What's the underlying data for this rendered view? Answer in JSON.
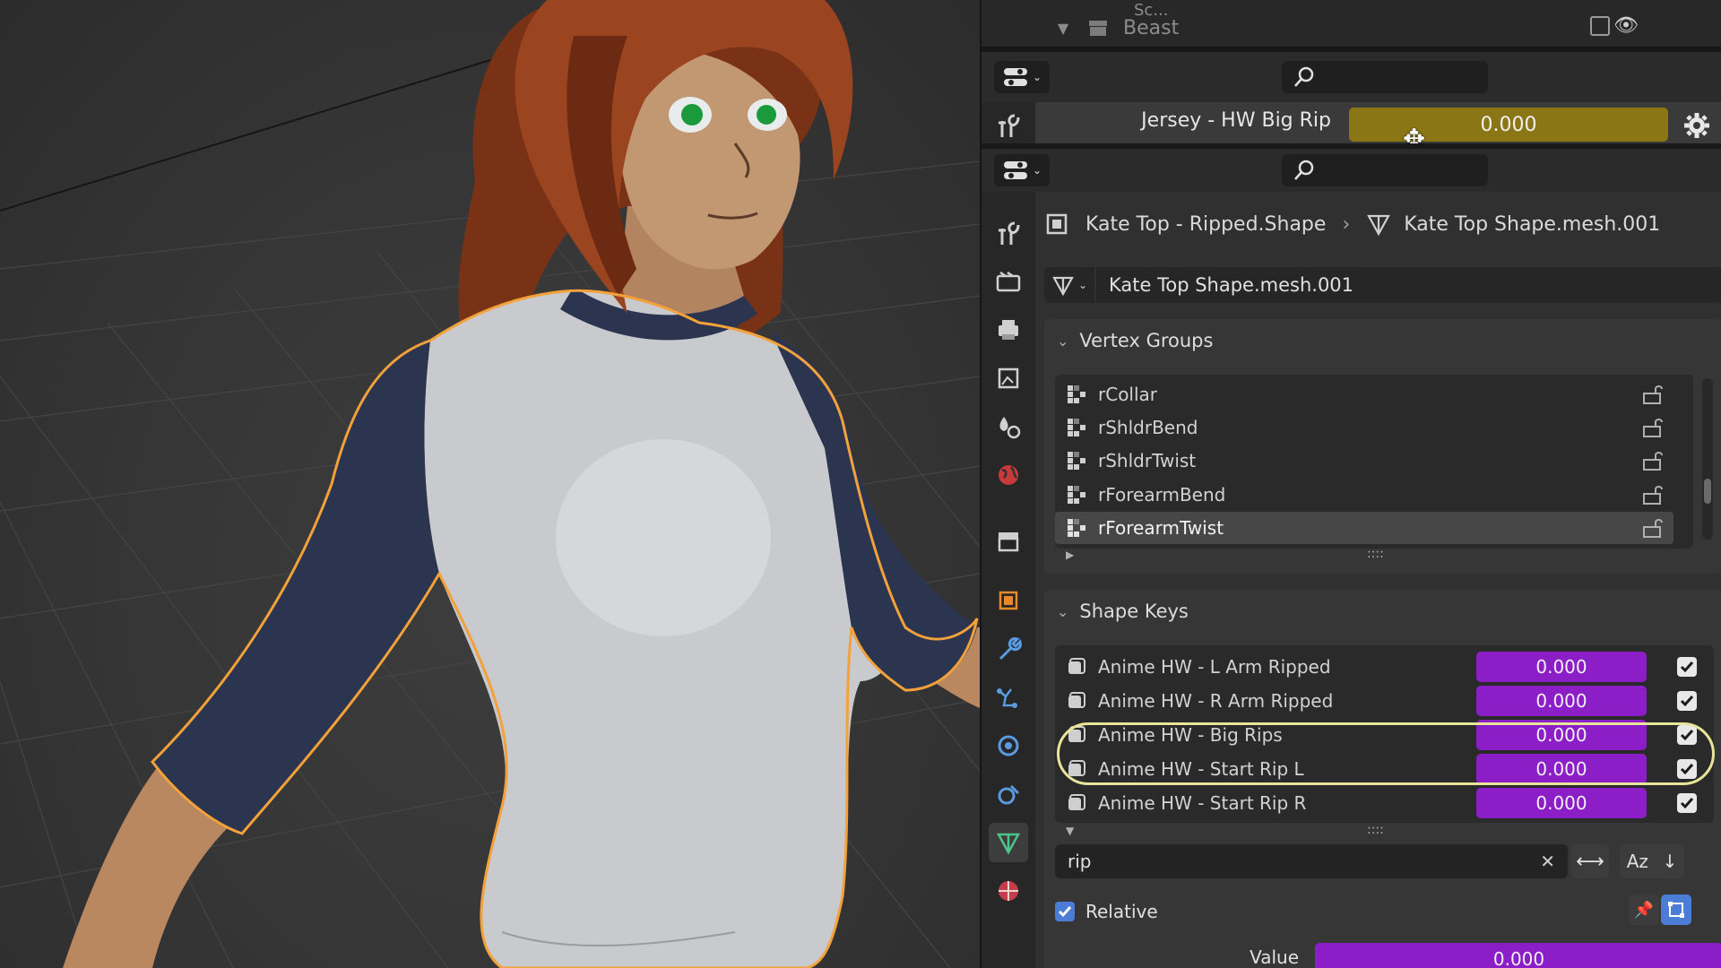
{
  "colors": {
    "selection_outline": "#f3a13a",
    "key_value_field": "#8c1ec8",
    "driver_field": "#8b7615",
    "highlight_circle": "#e8e49a",
    "shirt_sleeve": "#2c3550",
    "shirt_body": "#c8c9cc",
    "hair": "#8a3a1a",
    "eyes": "#1a9a3a"
  },
  "outliner": {
    "item_above_label": "Sc...",
    "collection_label": "Beast"
  },
  "driver_row": {
    "label": "Jersey - HW Big Rip",
    "value": "0.000"
  },
  "breadcrumb": {
    "object": "Kate Top - Ripped.Shape",
    "mesh": "Kate Top Shape.mesh.001"
  },
  "mesh_selector": {
    "name": "Kate Top Shape.mesh.001"
  },
  "vertex_groups": {
    "title": "Vertex Groups",
    "items": [
      "rCollar",
      "rShldrBend",
      "rShldrTwist",
      "rForearmBend",
      "rForearmTwist"
    ],
    "grip": "::::"
  },
  "shape_keys": {
    "title": "Shape Keys",
    "items": [
      {
        "name": "Anime HW - L Arm Ripped",
        "value": "0.000"
      },
      {
        "name": "Anime HW - R Arm Ripped",
        "value": "0.000"
      },
      {
        "name": "Anime HW - Big Rips",
        "value": "0.000"
      },
      {
        "name": "Anime HW - Start Rip L",
        "value": "0.000"
      },
      {
        "name": "Anime HW - Start Rip R",
        "value": "0.000"
      }
    ],
    "grip": "::::",
    "filter_value": "rip",
    "sort_label": "Az",
    "relative_label": "Relative",
    "value_label": "Value",
    "value": "0.000"
  }
}
